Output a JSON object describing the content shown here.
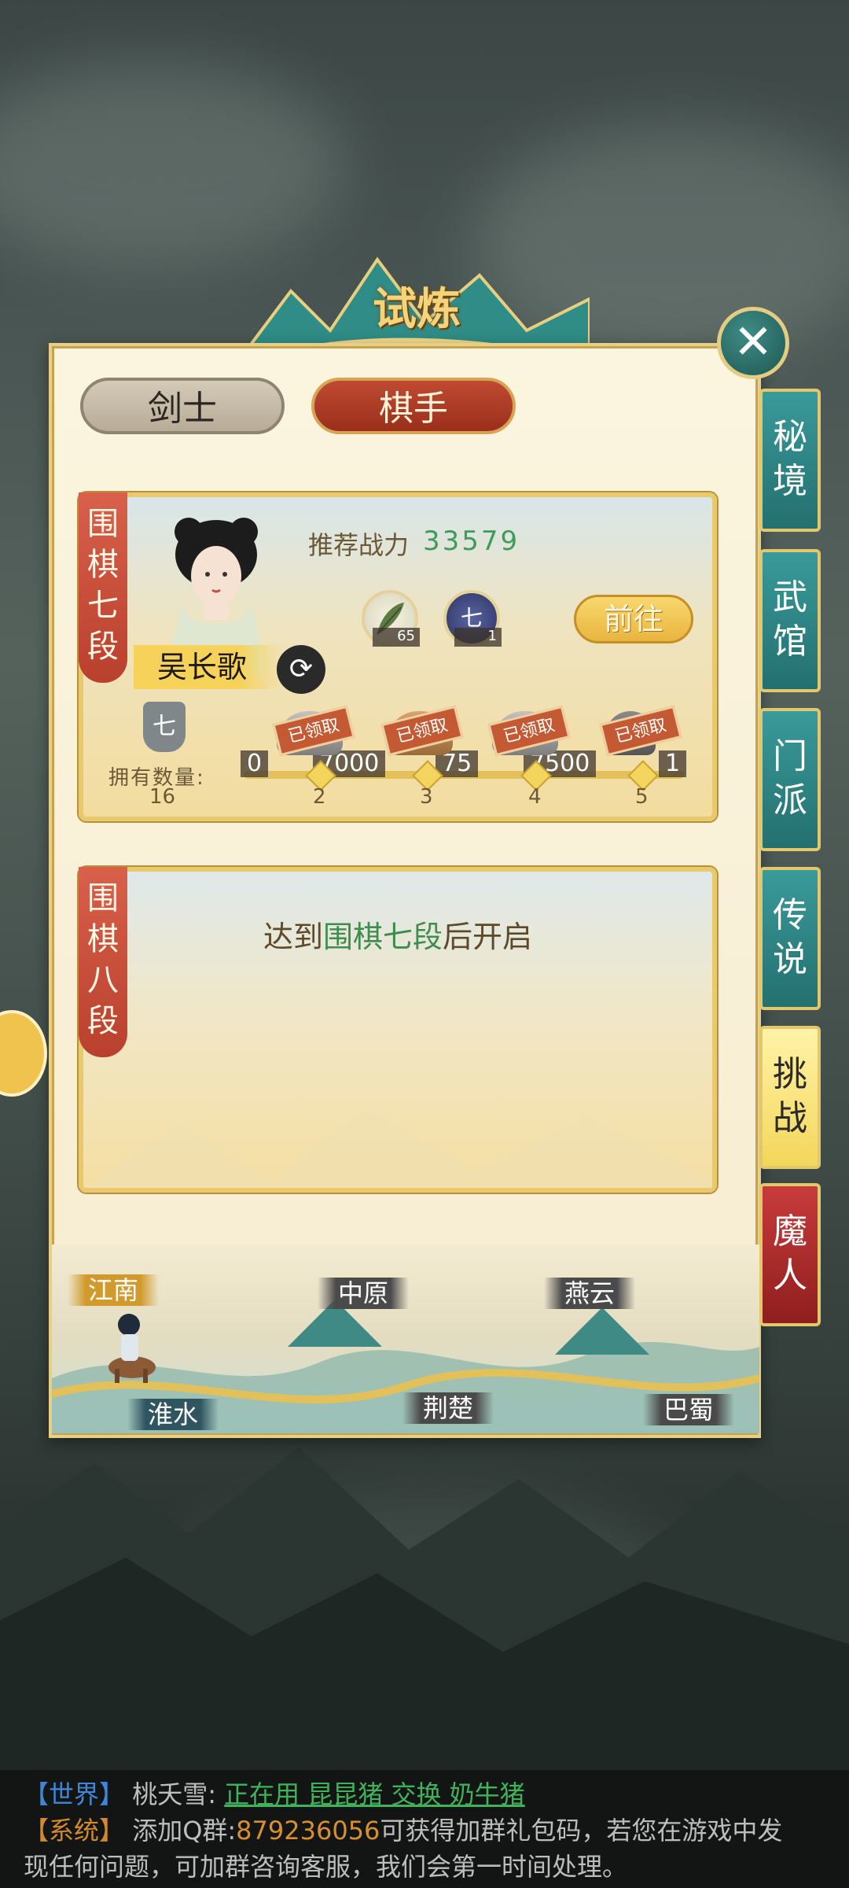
{
  "header": {
    "title": "试炼"
  },
  "tabs": [
    {
      "label": "剑士",
      "active": false
    },
    {
      "label": "棋手",
      "active": true
    }
  ],
  "side_tabs": [
    {
      "label": "秘境",
      "active": false
    },
    {
      "label": "武馆",
      "active": false
    },
    {
      "label": "门派",
      "active": false
    },
    {
      "label": "传说",
      "active": false
    },
    {
      "label": "挑战",
      "active": true
    },
    {
      "label": "魔人",
      "active": false
    }
  ],
  "card1": {
    "rank": "围棋七段",
    "recommend_label": "推荐战力",
    "recommend_value": "33579",
    "character_name": "吴长歌",
    "items": [
      {
        "icon": "herb-icon",
        "count": "65"
      },
      {
        "icon": "chess-token-icon",
        "glyph": "七",
        "count": "1"
      }
    ],
    "goto_label": "前往",
    "own_icon_glyph": "七",
    "own_label": "拥有数量:",
    "own_count": "16",
    "claimed_stamp": "已领取",
    "rewards": [
      {
        "amount": "0",
        "node": ""
      },
      {
        "amount": "7000",
        "node": "2"
      },
      {
        "amount": "75",
        "node": "3"
      },
      {
        "amount": "7500",
        "node": "4"
      },
      {
        "amount": "1",
        "node": "5"
      }
    ]
  },
  "card2": {
    "rank": "围棋八段",
    "lock_prefix": "达到",
    "lock_highlight": "围棋七段",
    "lock_suffix": "后开启"
  },
  "map": {
    "locations": [
      "江南",
      "中原",
      "燕云",
      "淮水",
      "荆楚",
      "巴蜀"
    ],
    "current": "江南"
  },
  "chat": {
    "line1_channel": "【世界】",
    "line1_user": "桃夭雪:",
    "line1_msg": "正在用 昆昆猪 交换 奶牛猪",
    "line2_channel": "【系统】",
    "line2_pre": "添加Q群:",
    "line2_qq": "879236056",
    "line2_post": "可获得加群礼包码，若您在游戏中发",
    "line3": "现任何问题，可加群咨询客服，我们会第一时间处理。"
  }
}
